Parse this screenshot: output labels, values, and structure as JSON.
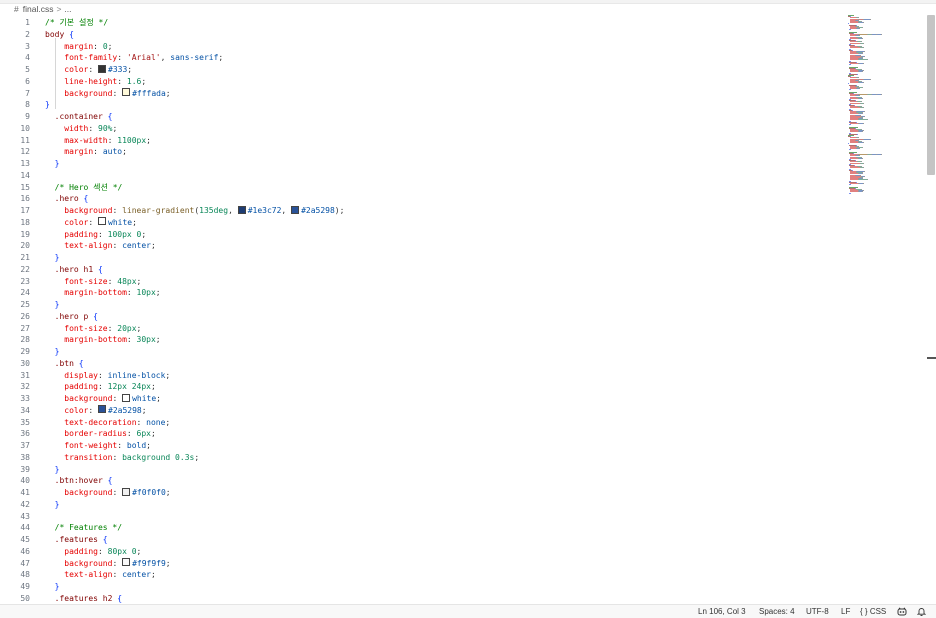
{
  "breadcrumb": {
    "file": "final.css",
    "separator": ">",
    "trail": "..."
  },
  "colors": {
    "swatch_333": "#333333",
    "swatch_fffada": "#fffada",
    "swatch_1e3c72": "#1e3c72",
    "swatch_2a5298": "#2a5298",
    "swatch_white": "#ffffff",
    "swatch_f0f0f0": "#f0f0f0",
    "swatch_f9f9f9": "#f9f9f9"
  },
  "code": {
    "line_numbers": [
      "1",
      "2",
      "3",
      "4",
      "5",
      "6",
      "7",
      "8",
      "9",
      "10",
      "11",
      "12",
      "13",
      "14",
      "15",
      "16",
      "17",
      "18",
      "19",
      "20",
      "21",
      "22",
      "23",
      "24",
      "25",
      "26",
      "27",
      "28",
      "29",
      "30",
      "31",
      "32",
      "33",
      "34",
      "35",
      "36",
      "37",
      "38",
      "39",
      "40",
      "41",
      "42",
      "43",
      "44",
      "45",
      "46",
      "47",
      "48",
      "49",
      "50"
    ],
    "lines": [
      [
        {
          "t": "/* 기본 설정 */",
          "c": "comment"
        }
      ],
      [
        {
          "t": "body ",
          "c": "sel"
        },
        {
          "t": "{",
          "c": "brace"
        }
      ],
      [
        {
          "t": "    margin",
          "c": "prop"
        },
        {
          "t": ": "
        },
        {
          "t": "0",
          "c": "num"
        },
        {
          "t": ";"
        }
      ],
      [
        {
          "t": "    font-family",
          "c": "prop"
        },
        {
          "t": ": "
        },
        {
          "t": "'Arial'",
          "c": "str"
        },
        {
          "t": ", "
        },
        {
          "t": "sans-serif",
          "c": "kw"
        },
        {
          "t": ";"
        }
      ],
      [
        {
          "t": "    color",
          "c": "prop"
        },
        {
          "t": ": "
        },
        {
          "sw": "#333333"
        },
        {
          "t": "#333",
          "c": "kw"
        },
        {
          "t": ";"
        }
      ],
      [
        {
          "t": "    line-height",
          "c": "prop"
        },
        {
          "t": ": "
        },
        {
          "t": "1.6",
          "c": "num"
        },
        {
          "t": ";"
        }
      ],
      [
        {
          "t": "    background",
          "c": "prop"
        },
        {
          "t": ": "
        },
        {
          "sw": "#fffada"
        },
        {
          "t": "#fffada",
          "c": "kw"
        },
        {
          "t": ";"
        }
      ],
      [
        {
          "t": "}",
          "c": "brace"
        }
      ],
      [
        {
          "t": "  .container ",
          "c": "sel"
        },
        {
          "t": "{",
          "c": "brace"
        }
      ],
      [
        {
          "t": "    width",
          "c": "prop"
        },
        {
          "t": ": "
        },
        {
          "t": "90%",
          "c": "num"
        },
        {
          "t": ";"
        }
      ],
      [
        {
          "t": "    max-width",
          "c": "prop"
        },
        {
          "t": ": "
        },
        {
          "t": "1100px",
          "c": "num"
        },
        {
          "t": ";"
        }
      ],
      [
        {
          "t": "    margin",
          "c": "prop"
        },
        {
          "t": ": "
        },
        {
          "t": "auto",
          "c": "kw"
        },
        {
          "t": ";"
        }
      ],
      [
        {
          "t": "  }",
          "c": "brace"
        }
      ],
      [
        {
          "t": ""
        }
      ],
      [
        {
          "t": "  /* Hero 섹션 */",
          "c": "comment"
        }
      ],
      [
        {
          "t": "  .hero ",
          "c": "sel"
        },
        {
          "t": "{",
          "c": "brace"
        }
      ],
      [
        {
          "t": "    background",
          "c": "prop"
        },
        {
          "t": ": "
        },
        {
          "t": "linear-gradient",
          "c": "fn"
        },
        {
          "t": "("
        },
        {
          "t": "135deg",
          "c": "num"
        },
        {
          "t": ", "
        },
        {
          "sw": "#1e3c72"
        },
        {
          "t": "#1e3c72",
          "c": "kw"
        },
        {
          "t": ", "
        },
        {
          "sw": "#2a5298"
        },
        {
          "t": "#2a5298",
          "c": "kw"
        },
        {
          "t": ");"
        }
      ],
      [
        {
          "t": "    color",
          "c": "prop"
        },
        {
          "t": ": "
        },
        {
          "sw": "#ffffff"
        },
        {
          "t": "white",
          "c": "kw"
        },
        {
          "t": ";"
        }
      ],
      [
        {
          "t": "    padding",
          "c": "prop"
        },
        {
          "t": ": "
        },
        {
          "t": "100px 0",
          "c": "num"
        },
        {
          "t": ";"
        }
      ],
      [
        {
          "t": "    text-align",
          "c": "prop"
        },
        {
          "t": ": "
        },
        {
          "t": "center",
          "c": "kw"
        },
        {
          "t": ";"
        }
      ],
      [
        {
          "t": "  }",
          "c": "brace"
        }
      ],
      [
        {
          "t": "  .hero h1 ",
          "c": "sel"
        },
        {
          "t": "{",
          "c": "brace"
        }
      ],
      [
        {
          "t": "    font-size",
          "c": "prop"
        },
        {
          "t": ": "
        },
        {
          "t": "48px",
          "c": "num"
        },
        {
          "t": ";"
        }
      ],
      [
        {
          "t": "    margin-bottom",
          "c": "prop"
        },
        {
          "t": ": "
        },
        {
          "t": "10px",
          "c": "num"
        },
        {
          "t": ";"
        }
      ],
      [
        {
          "t": "  }",
          "c": "brace"
        }
      ],
      [
        {
          "t": "  .hero p ",
          "c": "sel"
        },
        {
          "t": "{",
          "c": "brace"
        }
      ],
      [
        {
          "t": "    font-size",
          "c": "prop"
        },
        {
          "t": ": "
        },
        {
          "t": "20px",
          "c": "num"
        },
        {
          "t": ";"
        }
      ],
      [
        {
          "t": "    margin-bottom",
          "c": "prop"
        },
        {
          "t": ": "
        },
        {
          "t": "30px",
          "c": "num"
        },
        {
          "t": ";"
        }
      ],
      [
        {
          "t": "  }",
          "c": "brace"
        }
      ],
      [
        {
          "t": "  .btn ",
          "c": "sel"
        },
        {
          "t": "{",
          "c": "brace"
        }
      ],
      [
        {
          "t": "    display",
          "c": "prop"
        },
        {
          "t": ": "
        },
        {
          "t": "inline-block",
          "c": "kw"
        },
        {
          "t": ";"
        }
      ],
      [
        {
          "t": "    padding",
          "c": "prop"
        },
        {
          "t": ": "
        },
        {
          "t": "12px 24px",
          "c": "num"
        },
        {
          "t": ";"
        }
      ],
      [
        {
          "t": "    background",
          "c": "prop"
        },
        {
          "t": ": "
        },
        {
          "sw": "#ffffff"
        },
        {
          "t": "white",
          "c": "kw"
        },
        {
          "t": ";"
        }
      ],
      [
        {
          "t": "    color",
          "c": "prop"
        },
        {
          "t": ": "
        },
        {
          "sw": "#2a5298"
        },
        {
          "t": "#2a5298",
          "c": "kw"
        },
        {
          "t": ";"
        }
      ],
      [
        {
          "t": "    text-decoration",
          "c": "prop"
        },
        {
          "t": ": "
        },
        {
          "t": "none",
          "c": "kw"
        },
        {
          "t": ";"
        }
      ],
      [
        {
          "t": "    border-radius",
          "c": "prop"
        },
        {
          "t": ": "
        },
        {
          "t": "6px",
          "c": "num"
        },
        {
          "t": ";"
        }
      ],
      [
        {
          "t": "    font-weight",
          "c": "prop"
        },
        {
          "t": ": "
        },
        {
          "t": "bold",
          "c": "kw"
        },
        {
          "t": ";"
        }
      ],
      [
        {
          "t": "    transition",
          "c": "prop"
        },
        {
          "t": ": "
        },
        {
          "t": "background 0.3s",
          "c": "num"
        },
        {
          "t": ";"
        }
      ],
      [
        {
          "t": "  }",
          "c": "brace"
        }
      ],
      [
        {
          "t": "  .btn:hover ",
          "c": "sel"
        },
        {
          "t": "{",
          "c": "brace"
        }
      ],
      [
        {
          "t": "    background",
          "c": "prop"
        },
        {
          "t": ": "
        },
        {
          "sw": "#f0f0f0"
        },
        {
          "t": "#f0f0f0",
          "c": "kw"
        },
        {
          "t": ";"
        }
      ],
      [
        {
          "t": "  }",
          "c": "brace"
        }
      ],
      [
        {
          "t": ""
        }
      ],
      [
        {
          "t": "  /* Features */",
          "c": "comment"
        }
      ],
      [
        {
          "t": "  .features ",
          "c": "sel"
        },
        {
          "t": "{",
          "c": "brace"
        }
      ],
      [
        {
          "t": "    padding",
          "c": "prop"
        },
        {
          "t": ": "
        },
        {
          "t": "80px 0",
          "c": "num"
        },
        {
          "t": ";"
        }
      ],
      [
        {
          "t": "    background",
          "c": "prop"
        },
        {
          "t": ": "
        },
        {
          "sw": "#f9f9f9"
        },
        {
          "t": "#f9f9f9",
          "c": "kw"
        },
        {
          "t": ";"
        }
      ],
      [
        {
          "t": "    text-align",
          "c": "prop"
        },
        {
          "t": ": "
        },
        {
          "t": "center",
          "c": "kw"
        },
        {
          "t": ";"
        }
      ],
      [
        {
          "t": "  }",
          "c": "brace"
        }
      ],
      [
        {
          "t": "  .features h2 ",
          "c": "sel"
        },
        {
          "t": "{",
          "c": "brace"
        }
      ]
    ]
  },
  "statusbar": {
    "position": "Ln 106, Col 3",
    "spaces": "Spaces: 4",
    "encoding": "UTF-8",
    "eol": "LF",
    "language_icon": "{ }",
    "language": "CSS",
    "copilot_icon": "copilot-icon",
    "bell_icon": "bell-icon"
  }
}
